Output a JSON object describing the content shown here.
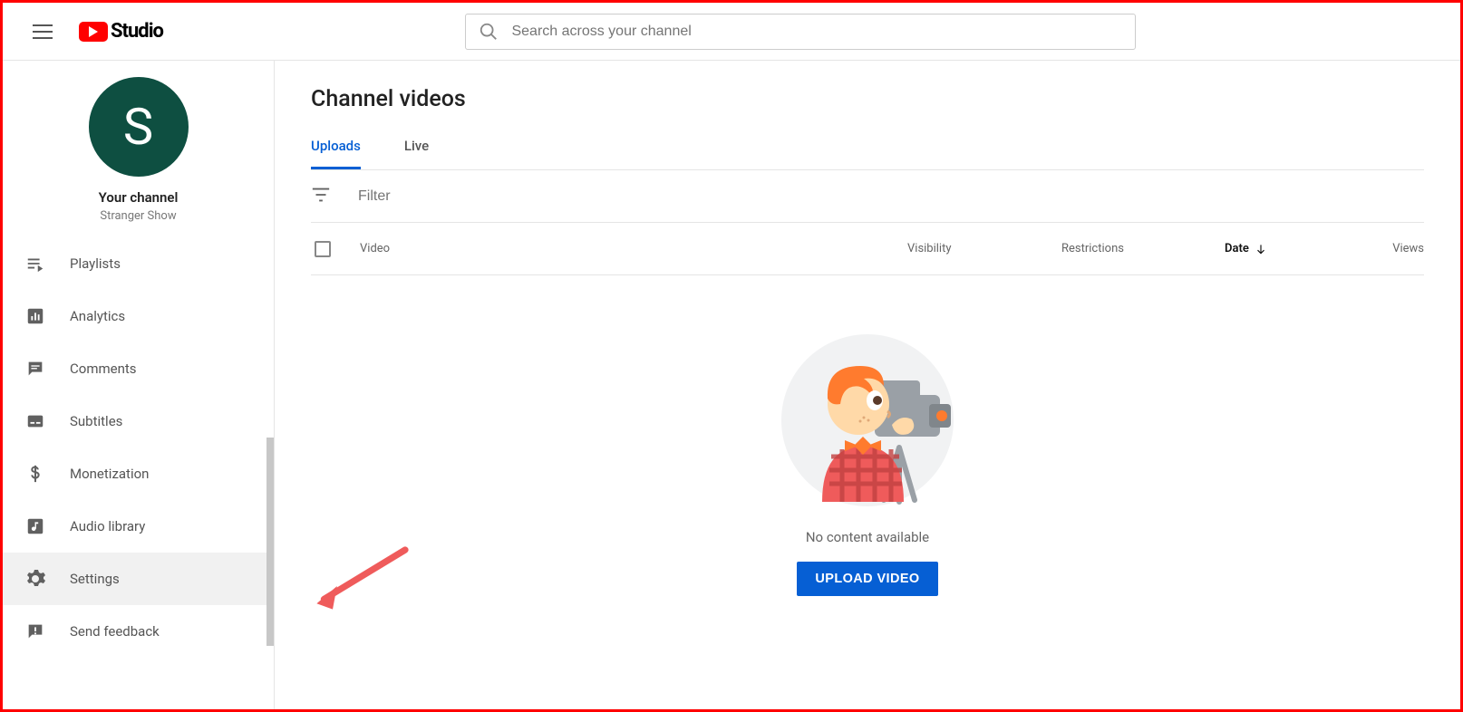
{
  "header": {
    "logo_text": "Studio",
    "search_placeholder": "Search across your channel"
  },
  "sidebar": {
    "avatar_letter": "S",
    "your_channel": "Your channel",
    "channel_name": "Stranger Show",
    "items": [
      {
        "icon": "playlists",
        "label": "Playlists"
      },
      {
        "icon": "analytics",
        "label": "Analytics"
      },
      {
        "icon": "comments",
        "label": "Comments"
      },
      {
        "icon": "subtitles",
        "label": "Subtitles"
      },
      {
        "icon": "monetization",
        "label": "Monetization"
      },
      {
        "icon": "audio",
        "label": "Audio library"
      },
      {
        "icon": "settings",
        "label": "Settings"
      },
      {
        "icon": "feedback",
        "label": "Send feedback"
      }
    ]
  },
  "main": {
    "title": "Channel videos",
    "tabs": [
      {
        "label": "Uploads",
        "active": true
      },
      {
        "label": "Live",
        "active": false
      }
    ],
    "filter_placeholder": "Filter",
    "columns": {
      "video": "Video",
      "visibility": "Visibility",
      "restrictions": "Restrictions",
      "date": "Date",
      "views": "Views"
    },
    "sort_column": "Date",
    "sort_direction": "desc",
    "empty_message": "No content available",
    "upload_button": "UPLOAD VIDEO"
  }
}
